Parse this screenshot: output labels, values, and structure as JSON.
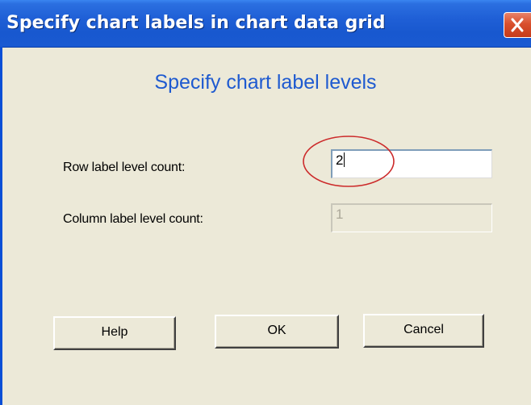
{
  "window": {
    "title": "Specify chart labels in chart data grid",
    "close_glyph": "✕"
  },
  "dialog": {
    "heading": "Specify chart label levels",
    "row_label": "Row label level count:",
    "row_value": "2",
    "column_label": "Column label level count:",
    "column_value": "1",
    "column_enabled": false
  },
  "buttons": {
    "help": "Help",
    "ok": "OK",
    "cancel": "Cancel"
  },
  "annotation": {
    "shape": "red-ellipse-icon",
    "color": "#cc0000"
  },
  "colors": {
    "titlebar": "#1f5fd6",
    "dialog_bg": "#ece9d8",
    "heading": "#1e5ad0",
    "close": "#d9502d"
  }
}
